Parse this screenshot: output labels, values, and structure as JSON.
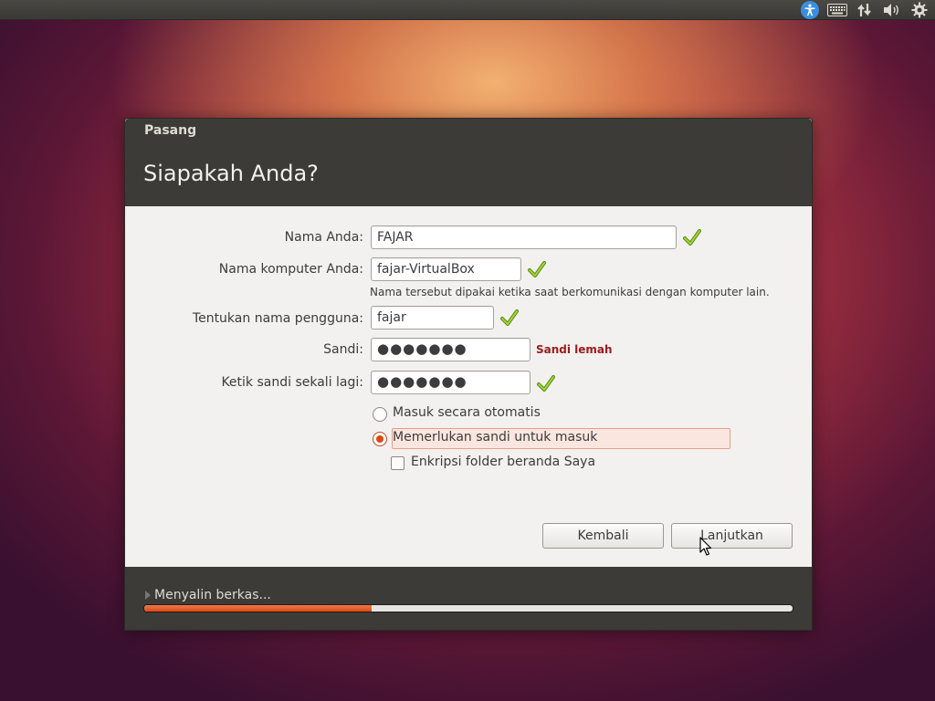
{
  "panel": {
    "icons": [
      "accessibility-icon",
      "keyboard-icon",
      "network-icon",
      "volume-icon",
      "settings-gear-icon"
    ]
  },
  "window": {
    "title": "Pasang",
    "page_title": "Siapakah Anda?"
  },
  "form": {
    "name_label": "Nama Anda:",
    "name_value": "FAJAR",
    "computer_label": "Nama komputer Anda:",
    "computer_value": "fajar-VirtualBox",
    "computer_hint": "Nama tersebut dipakai ketika saat berkomunikasi dengan komputer lain.",
    "username_label": "Tentukan nama pengguna:",
    "username_value": "fajar",
    "password_label": "Sandi:",
    "password_value": "●●●●●●●",
    "password_strength": "Sandi lemah",
    "confirm_label": "Ketik sandi sekali lagi:",
    "confirm_value": "●●●●●●●",
    "login_options": [
      {
        "label": "Masuk secara otomatis",
        "selected": false
      },
      {
        "label": "Memerlukan sandi untuk masuk",
        "selected": true
      }
    ],
    "encrypt_label": "Enkripsi folder beranda Saya",
    "encrypt_checked": false
  },
  "buttons": {
    "back": "Kembali",
    "continue": "Lanjutkan"
  },
  "footer": {
    "status": "Menyalin berkas...",
    "progress": 0.35
  },
  "colors": {
    "accent": "#dd4814",
    "check_green": "#7cb716",
    "weak_red": "#9e1a1a",
    "header_bg": "#3c3b37"
  }
}
